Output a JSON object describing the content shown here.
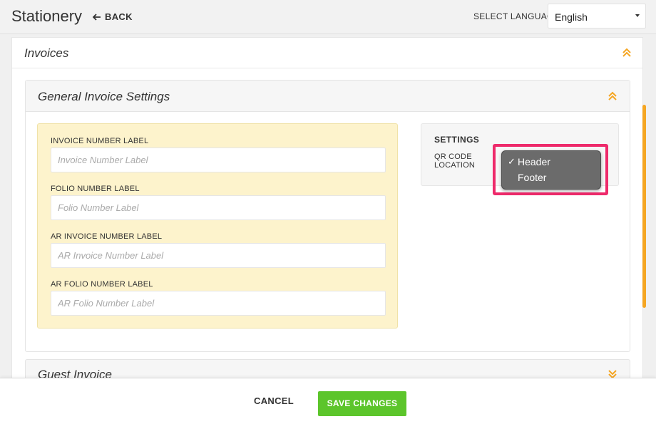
{
  "header": {
    "title": "Stationery",
    "back_label": "BACK",
    "language_label": "SELECT LANGUAGE",
    "language_value": "English"
  },
  "invoices": {
    "title": "Invoices"
  },
  "general_settings": {
    "title": "General Invoice Settings",
    "fields": [
      {
        "label": "INVOICE NUMBER LABEL",
        "placeholder": "Invoice Number Label",
        "value": ""
      },
      {
        "label": "FOLIO NUMBER LABEL",
        "placeholder": "Folio Number Label",
        "value": ""
      },
      {
        "label": "AR INVOICE NUMBER LABEL",
        "placeholder": "AR Invoice Number Label",
        "value": ""
      },
      {
        "label": "AR FOLIO NUMBER LABEL",
        "placeholder": "AR Folio Number Label",
        "value": ""
      }
    ],
    "settings": {
      "title": "SETTINGS",
      "qr_label": "QR CODE LOCATION",
      "options": [
        "Header",
        "Footer"
      ],
      "selected": "Header",
      "check_mark": "✓"
    }
  },
  "guest_invoice": {
    "title": "Guest Invoice"
  },
  "footer": {
    "cancel_label": "CANCEL",
    "save_label": "SAVE CHANGES"
  },
  "colors": {
    "accent_orange": "#f5a623",
    "save_green": "#5cc52b",
    "highlight_pink": "#ee2a6b",
    "labels_box_bg": "#fdf3cc"
  },
  "icons": {
    "back": "arrow-left-icon",
    "collapse": "double-chevron-up-icon",
    "expand": "double-chevron-down-icon",
    "dropdown": "caret-down-icon"
  }
}
